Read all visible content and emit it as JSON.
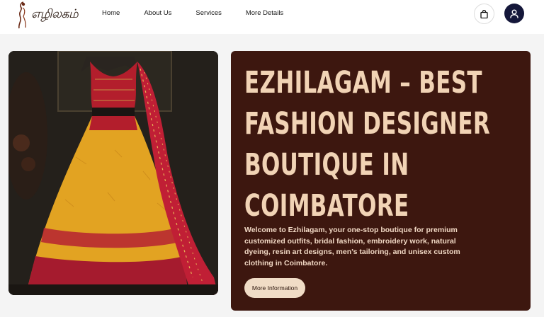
{
  "brand": {
    "logo_text": "எழிலகம்"
  },
  "nav": {
    "links": [
      {
        "label": "Home"
      },
      {
        "label": "About Us"
      },
      {
        "label": "Services"
      },
      {
        "label": "More Details"
      }
    ]
  },
  "header_actions": {
    "cart_icon": "shopping-bag-icon",
    "user_icon": "user-icon"
  },
  "hero": {
    "title_lines": [
      "EZHILAGAM – BEST",
      "FASHION DESIGNER",
      "BOUTIQUE IN",
      "COIMBATORE"
    ],
    "description": "Welcome to Ezhilagam, your one-stop boutique for premium customized outfits, bridal fashion, embroidery work, natural dyeing, resin art designs, men’s tailoring, and unisex custom clothing in Coimbatore.",
    "cta_label": "More Information"
  },
  "colors": {
    "hero_bg": "#3d170f",
    "hero_text": "#f1d3b5",
    "cta_bg": "#f0dcc6",
    "user_button": "#14173a"
  }
}
